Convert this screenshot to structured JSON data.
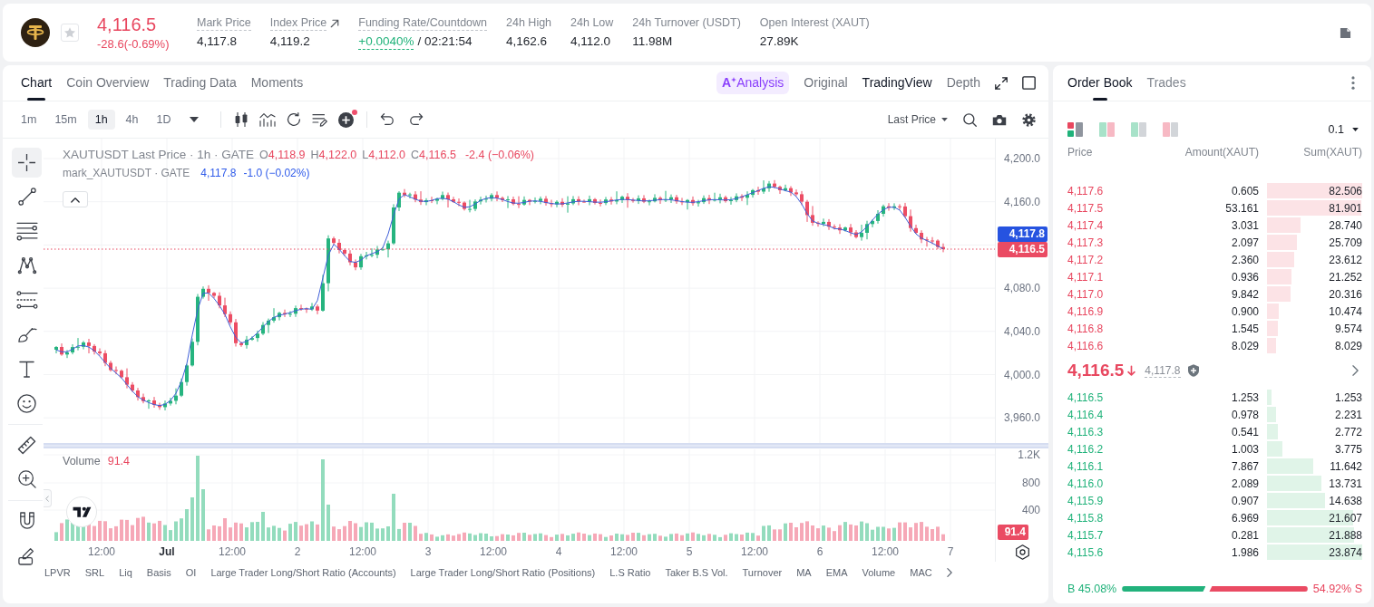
{
  "header": {
    "price": "4,116.5",
    "change": "-28.6(-0.69%)",
    "negative": true,
    "favorite": false,
    "stats": [
      {
        "kind": "plain",
        "label": "Mark Price",
        "value": "4,117.8",
        "tooltip": true
      },
      {
        "kind": "link",
        "label": "Index Price",
        "value": "4,119.2",
        "tooltip": true
      },
      {
        "kind": "funding",
        "label": "Funding Rate/Countdown",
        "value": "+0.0040%",
        "countdown": "/ 02:21:54",
        "tooltip": true
      },
      {
        "kind": "plain",
        "label": "24h High",
        "value": "4,162.6",
        "tooltip": false
      },
      {
        "kind": "plain",
        "label": "24h Low",
        "value": "4,112.0",
        "tooltip": false
      },
      {
        "kind": "plain",
        "label": "24h Turnover (USDT)",
        "value": "11.98M",
        "tooltip": false
      },
      {
        "kind": "plain",
        "label": "Open Interest (XAUT)",
        "value": "27.89K",
        "tooltip": false
      }
    ]
  },
  "chart_panel": {
    "tabs": [
      {
        "label": "Chart",
        "selected": true
      },
      {
        "label": "Coin Overview",
        "selected": false
      },
      {
        "label": "Trading Data",
        "selected": false
      },
      {
        "label": "Moments",
        "selected": false
      }
    ],
    "views": [
      {
        "kind": "ai",
        "badge": "A",
        "label": "Analysis",
        "selected": false
      },
      {
        "kind": "text",
        "label": "Original",
        "selected": false
      },
      {
        "kind": "text",
        "label": "TradingView",
        "selected": true
      },
      {
        "kind": "text",
        "label": "Depth",
        "selected": false
      }
    ],
    "intervals": [
      {
        "label": "1m",
        "selected": false
      },
      {
        "label": "15m",
        "selected": false
      },
      {
        "label": "1h",
        "selected": true
      },
      {
        "label": "4h",
        "selected": false
      },
      {
        "label": "1D",
        "selected": false
      }
    ],
    "price_source": "Last Price",
    "tool_groups": [
      [
        {
          "kind": "crosshair",
          "selected": true
        },
        {
          "kind": "trend-line",
          "selected": false
        },
        {
          "kind": "parallel-lines",
          "selected": false
        },
        {
          "kind": "pattern",
          "selected": false
        },
        {
          "kind": "level-lines",
          "selected": false
        },
        {
          "kind": "brush",
          "selected": false
        },
        {
          "kind": "text",
          "selected": false
        },
        {
          "kind": "smiley",
          "selected": false
        }
      ],
      [
        {
          "kind": "ruler",
          "selected": false
        },
        {
          "kind": "zoom-in",
          "selected": false
        }
      ],
      [
        {
          "kind": "magnet",
          "selected": false
        },
        {
          "kind": "pencil",
          "selected": false
        }
      ]
    ],
    "legend": {
      "title": "XAUTUSDT Last Price · 1h · GATE",
      "ohlc": [
        {
          "key": "O",
          "value": "4,118.9"
        },
        {
          "key": "H",
          "value": "4,122.0"
        },
        {
          "key": "L",
          "value": "4,112.0"
        },
        {
          "key": "C",
          "value": "4,116.5"
        }
      ],
      "change": "-2.4 (−0.06%)",
      "negative": true
    },
    "mark_legend": {
      "title": "mark_XAUTUSDT · GATE",
      "value": "4,117.8",
      "change": "-1.0 (−0.02%)"
    },
    "price_axis": [
      "4,200.0",
      "4,160.0",
      "4,080.0",
      "4,040.0",
      "4,000.0",
      "3,960.0"
    ],
    "price_tags": [
      {
        "kind": "mark",
        "value": "4,117.8"
      },
      {
        "kind": "last",
        "value": "4,116.5"
      }
    ],
    "volume": {
      "label": "Volume",
      "value": "91.4",
      "axis": [
        "1.2K",
        "800",
        "400"
      ],
      "tag": "91.4"
    },
    "time_axis": [
      {
        "label": "12:00",
        "bold": false
      },
      {
        "label": "Jul",
        "bold": true
      },
      {
        "label": "12:00",
        "bold": false
      },
      {
        "label": "2",
        "bold": false
      },
      {
        "label": "12:00",
        "bold": false
      },
      {
        "label": "3",
        "bold": false
      },
      {
        "label": "12:00",
        "bold": false
      },
      {
        "label": "4",
        "bold": false
      },
      {
        "label": "12:00",
        "bold": false
      },
      {
        "label": "5",
        "bold": false
      },
      {
        "label": "12:00",
        "bold": false
      },
      {
        "label": "6",
        "bold": false
      },
      {
        "label": "12:00",
        "bold": false
      },
      {
        "label": "7",
        "bold": false
      }
    ],
    "indicators": [
      "LPVR",
      "SRL",
      "Liq",
      "Basis",
      "OI",
      "Large Trader Long/Short Ratio (Accounts)",
      "Large Trader Long/Short Ratio (Positions)",
      "L.S Ratio",
      "Taker B.S Vol.",
      "Turnover",
      "MA",
      "EMA",
      "Volume",
      "MAC"
    ]
  },
  "order_book": {
    "tabs": [
      {
        "label": "Order Book",
        "selected": true
      },
      {
        "label": "Trades",
        "selected": false
      }
    ],
    "layouts": [
      {
        "kind": "both",
        "selected": true
      },
      {
        "kind": "split",
        "selected": false
      },
      {
        "kind": "bids",
        "selected": false
      },
      {
        "kind": "asks",
        "selected": false
      }
    ],
    "precision": "0.1",
    "columns": [
      "Price",
      "Amount(XAUT)",
      "Sum(XAUT)"
    ],
    "asks": [
      {
        "price": "4,117.6",
        "amount": "0.605",
        "sum": "82.506",
        "level": 1
      },
      {
        "price": "4,117.5",
        "amount": "53.161",
        "sum": "81.901",
        "level": 0.993
      },
      {
        "price": "4,117.4",
        "amount": "3.031",
        "sum": "28.740",
        "level": 0.348
      },
      {
        "price": "4,117.3",
        "amount": "2.097",
        "sum": "25.709",
        "level": 0.312
      },
      {
        "price": "4,117.2",
        "amount": "2.360",
        "sum": "23.612",
        "level": 0.286
      },
      {
        "price": "4,117.1",
        "amount": "0.936",
        "sum": "21.252",
        "level": 0.258
      },
      {
        "price": "4,117.0",
        "amount": "9.842",
        "sum": "20.316",
        "level": 0.246
      },
      {
        "price": "4,116.9",
        "amount": "0.900",
        "sum": "10.474",
        "level": 0.127
      },
      {
        "price": "4,116.8",
        "amount": "1.545",
        "sum": "9.574",
        "level": 0.116
      },
      {
        "price": "4,116.6",
        "amount": "8.029",
        "sum": "8.029",
        "level": 0.097
      }
    ],
    "last": {
      "price": "4,116.5",
      "mark": "4,117.8",
      "negative": true
    },
    "bids": [
      {
        "price": "4,116.5",
        "amount": "1.253",
        "sum": "1.253",
        "level": 0.052
      },
      {
        "price": "4,116.4",
        "amount": "0.978",
        "sum": "2.231",
        "level": 0.093
      },
      {
        "price": "4,116.3",
        "amount": "0.541",
        "sum": "2.772",
        "level": 0.116
      },
      {
        "price": "4,116.2",
        "amount": "1.003",
        "sum": "3.775",
        "level": 0.158
      },
      {
        "price": "4,116.1",
        "amount": "7.867",
        "sum": "11.642",
        "level": 0.488
      },
      {
        "price": "4,116.0",
        "amount": "2.089",
        "sum": "13.731",
        "level": 0.575
      },
      {
        "price": "4,115.9",
        "amount": "0.907",
        "sum": "14.638",
        "level": 0.613
      },
      {
        "price": "4,115.8",
        "amount": "6.969",
        "sum": "21.607",
        "level": 0.905
      },
      {
        "price": "4,115.7",
        "amount": "0.281",
        "sum": "21.888",
        "level": 0.917
      },
      {
        "price": "4,115.6",
        "amount": "1.986",
        "sum": "23.874",
        "level": 1
      }
    ],
    "ratio": {
      "buy": "B 45.08%",
      "sell": "54.92% S",
      "level": 0.4508
    }
  }
}
